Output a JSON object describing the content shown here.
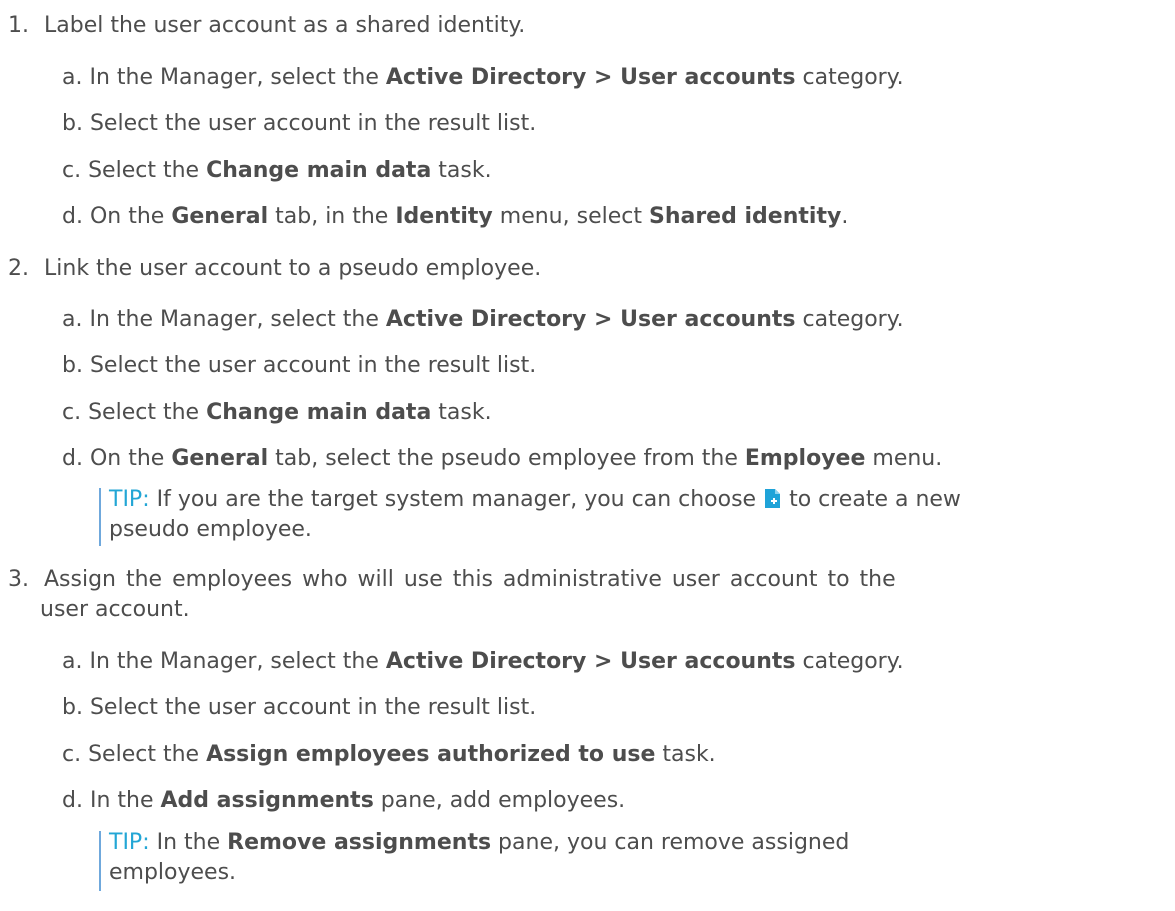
{
  "steps": [
    {
      "number": "1.",
      "text": "Label the user account as a shared identity.",
      "substeps": [
        {
          "letter": "a.",
          "parts": [
            "In the Manager, select the ",
            "Active Directory > User accounts",
            " category."
          ]
        },
        {
          "letter": "b.",
          "parts": [
            "Select the user account in the result list."
          ]
        },
        {
          "letter": "c.",
          "parts": [
            "Select the ",
            "Change main data",
            " task."
          ]
        },
        {
          "letter": "d.",
          "parts": [
            "On the ",
            "General",
            " tab, in the ",
            "Identity",
            " menu, select ",
            "Shared identity",
            "."
          ]
        }
      ]
    },
    {
      "number": "2.",
      "text": "Link the user account to a pseudo employee.",
      "substeps": [
        {
          "letter": "a.",
          "parts": [
            "In the Manager, select the ",
            "Active Directory > User accounts",
            " category."
          ]
        },
        {
          "letter": "b.",
          "parts": [
            "Select the user account in the result list."
          ]
        },
        {
          "letter": "c.",
          "parts": [
            "Select the ",
            "Change main data",
            " task."
          ]
        },
        {
          "letter": "d.",
          "parts": [
            "On the ",
            "General",
            " tab, select the pseudo employee from the ",
            "Employee",
            " menu."
          ]
        }
      ],
      "tip": {
        "label": "TIP:",
        "before_icon": " If you are the target system manager, you can choose ",
        "icon": "new-object-icon",
        "after_icon": " to create a new",
        "line2": "pseudo employee."
      }
    },
    {
      "number": "3.",
      "text_line1": "Assign the employees who will use this administrative user account to the",
      "text_line2": "user account.",
      "substeps": [
        {
          "letter": "a.",
          "parts": [
            "In the Manager, select the ",
            "Active Directory > User accounts",
            " category."
          ]
        },
        {
          "letter": "b.",
          "parts": [
            "Select the user account in the result list."
          ]
        },
        {
          "letter": "c.",
          "parts": [
            "Select the ",
            "Assign employees authorized to use",
            " task."
          ]
        },
        {
          "letter": "d.",
          "parts": [
            "In the ",
            "Add assignments",
            " pane, add employees."
          ]
        }
      ],
      "tip": {
        "label": "TIP:",
        "parts": [
          " In the ",
          "Remove assignments",
          " pane, you can remove assigned"
        ],
        "line2": "employees."
      }
    }
  ],
  "colors": {
    "text": "#4d4d4d",
    "tip": "#23a6d5",
    "bar": "#6fa8dc",
    "icon": "#1fa3d8"
  }
}
